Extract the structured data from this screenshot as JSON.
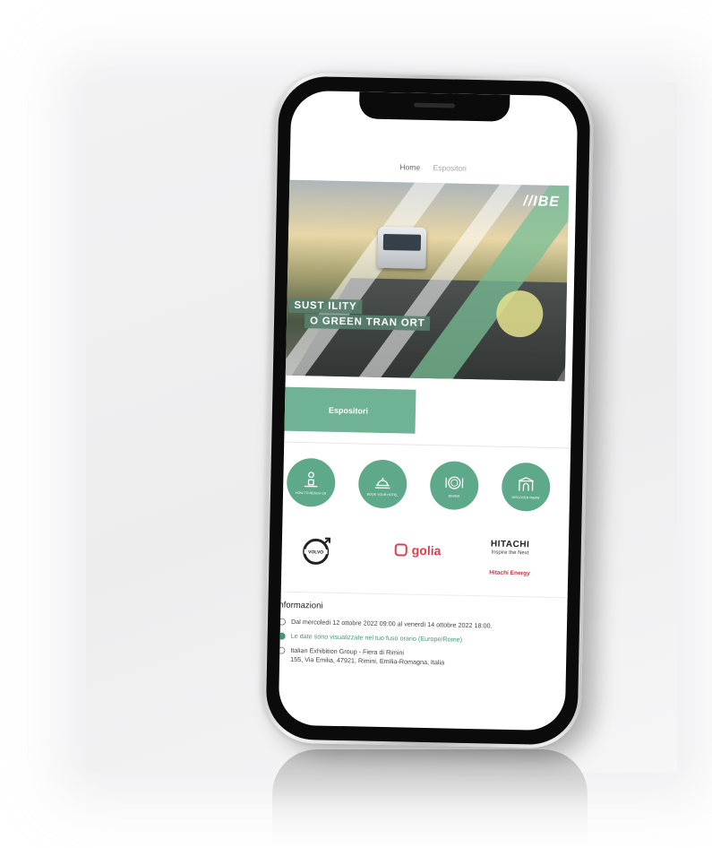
{
  "nav": {
    "home": "Home",
    "exhibitors": "Espositori"
  },
  "banner": {
    "logo": "//IBE",
    "slogan_line1": "SUST   ILITY",
    "slogan_line2": "O GREEN TRAN   ORT"
  },
  "cta": {
    "label": "Espositori"
  },
  "circles": [
    {
      "label": "HOW TO REACH US",
      "icon": "map-person-icon"
    },
    {
      "label": "BOOK YOUR HOTEL",
      "icon": "bell-icon"
    },
    {
      "label": "DINING",
      "icon": "plate-icon"
    },
    {
      "label": "DISCOVER RIMINI",
      "icon": "arch-icon"
    }
  ],
  "sponsors": {
    "volvo": "VOLVO",
    "golia": "golia",
    "hitachi": "HITACHI",
    "hitachi_tagline": "Inspire the Next",
    "hitachi_energy": "Hitachi Energy"
  },
  "info": {
    "title": "nformazioni",
    "dates": "Dal mercoledì 12 ottobre 2022 09:00 al venerdì 14 ottobre 2022 18:00.",
    "timezone": "Le date sono visualizzate nel tuo fuso orario (Europe/Rome)",
    "venue": "Italian Exhibition Group - Fiera di Rimini",
    "address": "155, Via Emilia, 47921, Rimini, Emilia-Romagna, Italia"
  },
  "colors": {
    "accent": "#5fa98b",
    "cta": "#6fb295",
    "link": "#3f9a74",
    "brand_red": "#d8404f"
  }
}
